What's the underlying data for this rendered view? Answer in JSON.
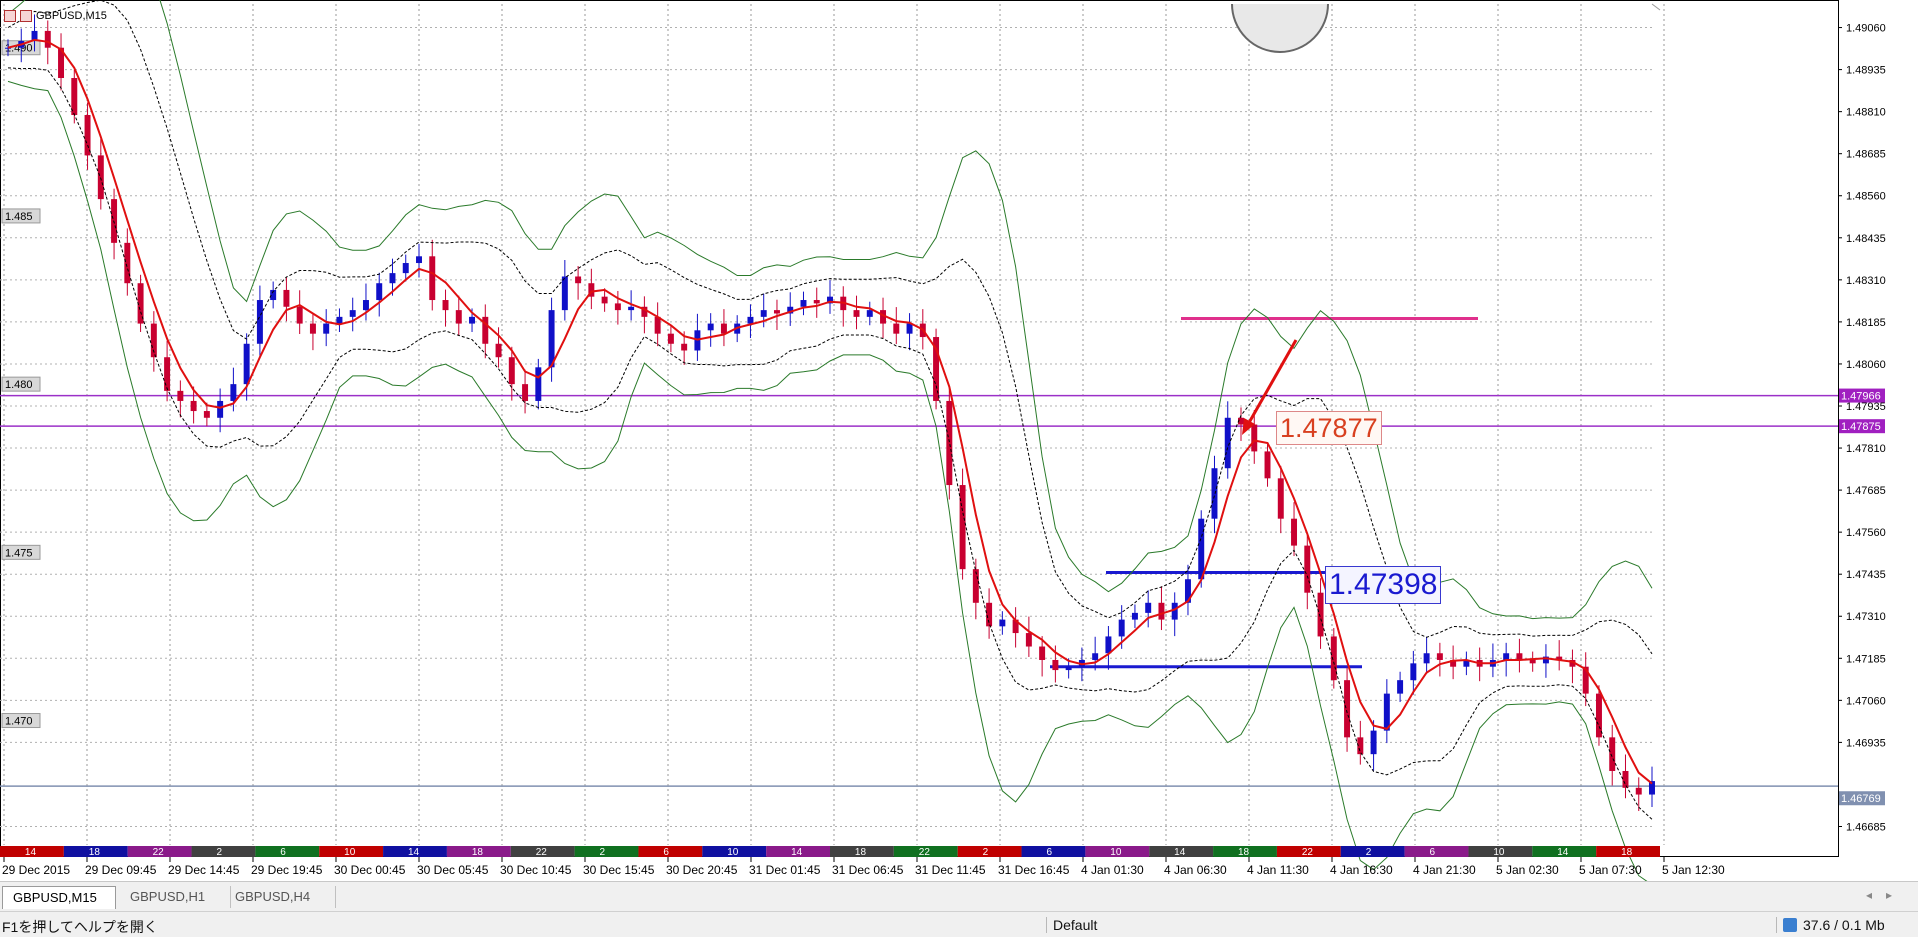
{
  "window": {
    "symbol_label": "GBPUSD,M15"
  },
  "chart_data": {
    "type": "candlestick",
    "symbol": "GBPUSD",
    "timeframe": "M15",
    "ylim": [
      1.4663,
      1.4913
    ],
    "y_ticks": [
      "1.49060",
      "1.48935",
      "1.48810",
      "1.48685",
      "1.48560",
      "1.48435",
      "1.48310",
      "1.48185",
      "1.48060",
      "1.47935",
      "1.47810",
      "1.47685",
      "1.47560",
      "1.47435",
      "1.47310",
      "1.47185",
      "1.47060",
      "1.46935",
      "1.46685"
    ],
    "x_ticks": [
      "29 Dec 2015",
      "29 Dec 09:45",
      "29 Dec 14:45",
      "29 Dec 19:45",
      "30 Dec 00:45",
      "30 Dec 05:45",
      "30 Dec 10:45",
      "30 Dec 15:45",
      "30 Dec 20:45",
      "31 Dec 01:45",
      "31 Dec 06:45",
      "31 Dec 11:45",
      "31 Dec 16:45",
      "4 Jan 01:30",
      "4 Jan 06:30",
      "4 Jan 11:30",
      "4 Jan 16:30",
      "4 Jan 21:30",
      "5 Jan 02:30",
      "5 Jan 07:30",
      "5 Jan 12:30"
    ],
    "round_levels": [
      "1.490",
      "1.485",
      "1.480",
      "1.475",
      "1.470"
    ],
    "hour_bar": [
      "14",
      "18",
      "22",
      "2",
      "6",
      "10",
      "14",
      "18",
      "22",
      "2",
      "6",
      "10",
      "14",
      "18",
      "22",
      "2",
      "6",
      "10",
      "14",
      "18",
      "22",
      "2",
      "6",
      "10",
      "14",
      "18"
    ],
    "current_price_labels": [
      {
        "text": "1.47966",
        "color": "#a020c0"
      },
      {
        "text": "1.47875",
        "color": "#a020c0"
      },
      {
        "text": "1.46769",
        "color": "#8090b0"
      }
    ],
    "horizontal_levels": [
      {
        "price": 1.47966,
        "color": "#9b30c8"
      },
      {
        "price": 1.47875,
        "color": "#9b30c8"
      },
      {
        "price": 1.48195,
        "color": "#e0308c"
      },
      {
        "price": 1.4744,
        "color": "#1a1ad0"
      },
      {
        "price": 1.4716,
        "color": "#1a1ad0"
      },
      {
        "price": 1.46805,
        "color": "#8090b0"
      }
    ],
    "annotations": [
      {
        "text": "1.47877",
        "color": "#d84020"
      },
      {
        "text": "1.47398",
        "color": "#1a1ad0"
      }
    ],
    "close": [
      1.49,
      1.4902,
      1.4905,
      1.49,
      1.4891,
      1.488,
      1.4868,
      1.4855,
      1.4842,
      1.483,
      1.4818,
      1.4808,
      1.4798,
      1.4795,
      1.4792,
      1.479,
      1.4795,
      1.48,
      1.4812,
      1.4825,
      1.4828,
      1.4823,
      1.4818,
      1.4815,
      1.4818,
      1.482,
      1.4822,
      1.4825,
      1.483,
      1.4833,
      1.4836,
      1.4838,
      1.4825,
      1.4822,
      1.4818,
      1.482,
      1.4812,
      1.4808,
      1.48,
      1.4795,
      1.4805,
      1.4822,
      1.4832,
      1.483,
      1.4826,
      1.4824,
      1.4822,
      1.4823,
      1.482,
      1.4815,
      1.4812,
      1.481,
      1.4816,
      1.4818,
      1.4815,
      1.4818,
      1.482,
      1.4822,
      1.4821,
      1.4823,
      1.4825,
      1.4824,
      1.4826,
      1.4822,
      1.482,
      1.4822,
      1.4818,
      1.4815,
      1.4818,
      1.4814,
      1.4795,
      1.477,
      1.4745,
      1.4735,
      1.4728,
      1.473,
      1.4726,
      1.4722,
      1.4718,
      1.4715,
      1.4716,
      1.4718,
      1.472,
      1.4725,
      1.473,
      1.4732,
      1.4735,
      1.473,
      1.4735,
      1.4742,
      1.476,
      1.4775,
      1.479,
      1.4788,
      1.478,
      1.4772,
      1.476,
      1.4752,
      1.4738,
      1.4725,
      1.4712,
      1.4695,
      1.469,
      1.4697,
      1.4708,
      1.4712,
      1.4717,
      1.472,
      1.4718,
      1.4716,
      1.4718,
      1.4716,
      1.4718,
      1.472,
      1.4718,
      1.4717,
      1.4719,
      1.4718,
      1.4716,
      1.4708,
      1.4695,
      1.4685,
      1.468,
      1.4678,
      1.4682
    ]
  },
  "tabs": [
    {
      "label": "GBPUSD,M15",
      "active": true
    },
    {
      "label": "GBPUSD,H1",
      "active": false
    },
    {
      "label": "GBPUSD,H4",
      "active": false
    }
  ],
  "status": {
    "help_text": "F1を押してヘルプを開く",
    "profile": "Default",
    "traffic": "37.6 / 0.1 Mb"
  }
}
